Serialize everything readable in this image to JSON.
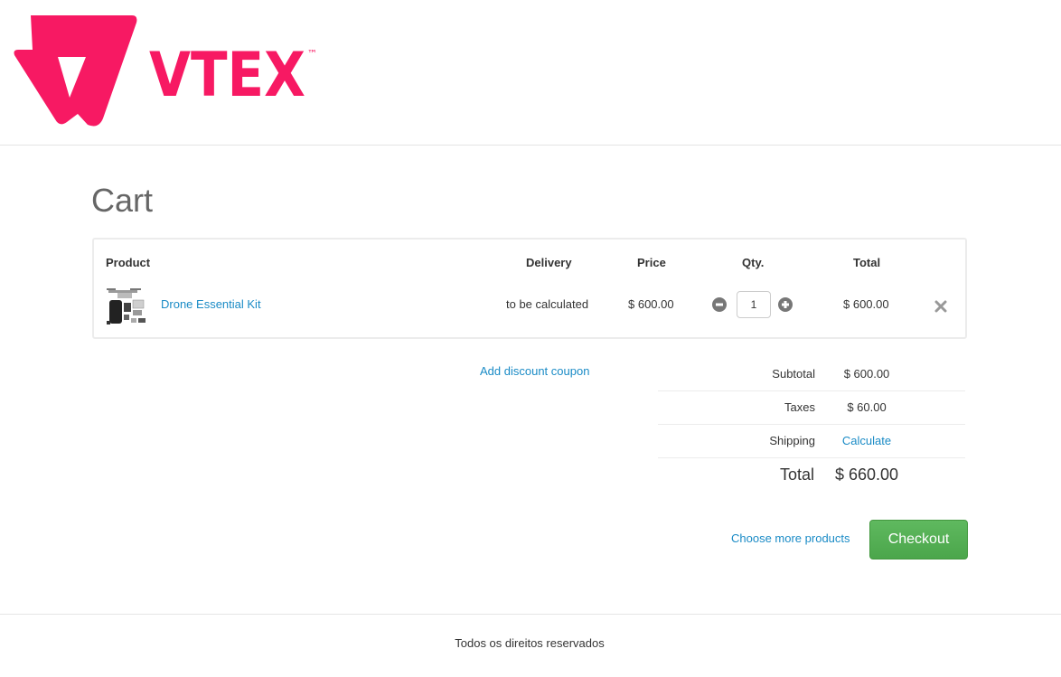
{
  "brand": {
    "name": "VTEX",
    "trademark": "™",
    "color": "#f71963"
  },
  "page": {
    "title": "Cart"
  },
  "cart_table": {
    "headers": {
      "product": "Product",
      "delivery": "Delivery",
      "price": "Price",
      "qty": "Qty.",
      "total": "Total"
    },
    "items": [
      {
        "name": "Drone Essential Kit",
        "delivery": "to be calculated",
        "price": "$ 600.00",
        "quantity": "1",
        "total": "$ 600.00"
      }
    ]
  },
  "coupon": {
    "label": "Add discount coupon"
  },
  "summary": {
    "subtotal_label": "Subtotal",
    "subtotal_value": "$ 600.00",
    "taxes_label": "Taxes",
    "taxes_value": "$ 60.00",
    "shipping_label": "Shipping",
    "shipping_value": "Calculate",
    "total_label": "Total",
    "total_value": "$ 660.00"
  },
  "actions": {
    "more_products": "Choose more products",
    "checkout": "Checkout"
  },
  "footer": {
    "text": "Todos os direitos reservados"
  },
  "colors": {
    "link": "#1a8bc6",
    "checkout_green": "#4ba64b"
  }
}
